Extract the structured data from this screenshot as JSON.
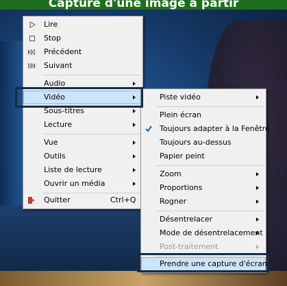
{
  "caption": "Capture d'une image à partir",
  "main_menu": {
    "items": [
      {
        "label": "Lire",
        "icon": "play-icon"
      },
      {
        "label": "Stop",
        "icon": "stop-icon"
      },
      {
        "label": "Précédent",
        "icon": "previous-icon"
      },
      {
        "label": "Suivant",
        "icon": "next-icon"
      },
      {
        "label": "Audio"
      },
      {
        "label": "Vidéo"
      },
      {
        "label": "Sous-titres"
      },
      {
        "label": "Lecture"
      },
      {
        "label": "Vue"
      },
      {
        "label": "Outils"
      },
      {
        "label": "Liste de lecture"
      },
      {
        "label": "Ouvrir un média"
      },
      {
        "label": "Quitter",
        "shortcut": "Ctrl+Q",
        "icon": "quit-icon"
      }
    ]
  },
  "video_menu": {
    "items": [
      {
        "label": "Piste vidéo"
      },
      {
        "label": "Plein écran"
      },
      {
        "label": "Toujours adapter à la Fenêtre",
        "checked": true
      },
      {
        "label": "Toujours au-dessus"
      },
      {
        "label": "Papier peint"
      },
      {
        "label": "Zoom"
      },
      {
        "label": "Proportions"
      },
      {
        "label": "Rogner"
      },
      {
        "label": "Désentrelacer"
      },
      {
        "label": "Mode de désentrelacement"
      },
      {
        "label": "Post-traitement",
        "disabled": true
      },
      {
        "label": "Prendre une capture d'écran"
      }
    ]
  },
  "colors": {
    "highlight": "#cce4f7",
    "frame": "#172b45",
    "caption_bg": "#1f6d1f",
    "check": "#1a5fb4"
  }
}
